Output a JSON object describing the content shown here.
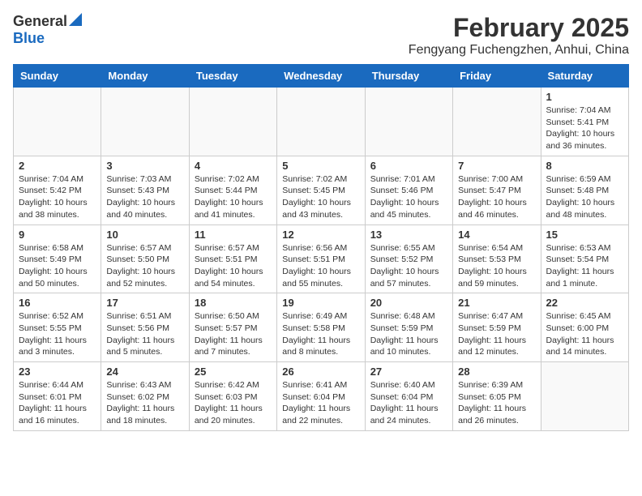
{
  "logo": {
    "general": "General",
    "blue": "Blue"
  },
  "title": "February 2025",
  "subtitle": "Fengyang Fuchengzhen, Anhui, China",
  "days_of_week": [
    "Sunday",
    "Monday",
    "Tuesday",
    "Wednesday",
    "Thursday",
    "Friday",
    "Saturday"
  ],
  "weeks": [
    [
      {
        "day": "",
        "info": ""
      },
      {
        "day": "",
        "info": ""
      },
      {
        "day": "",
        "info": ""
      },
      {
        "day": "",
        "info": ""
      },
      {
        "day": "",
        "info": ""
      },
      {
        "day": "",
        "info": ""
      },
      {
        "day": "1",
        "info": "Sunrise: 7:04 AM\nSunset: 5:41 PM\nDaylight: 10 hours and 36 minutes."
      }
    ],
    [
      {
        "day": "2",
        "info": "Sunrise: 7:04 AM\nSunset: 5:42 PM\nDaylight: 10 hours and 38 minutes."
      },
      {
        "day": "3",
        "info": "Sunrise: 7:03 AM\nSunset: 5:43 PM\nDaylight: 10 hours and 40 minutes."
      },
      {
        "day": "4",
        "info": "Sunrise: 7:02 AM\nSunset: 5:44 PM\nDaylight: 10 hours and 41 minutes."
      },
      {
        "day": "5",
        "info": "Sunrise: 7:02 AM\nSunset: 5:45 PM\nDaylight: 10 hours and 43 minutes."
      },
      {
        "day": "6",
        "info": "Sunrise: 7:01 AM\nSunset: 5:46 PM\nDaylight: 10 hours and 45 minutes."
      },
      {
        "day": "7",
        "info": "Sunrise: 7:00 AM\nSunset: 5:47 PM\nDaylight: 10 hours and 46 minutes."
      },
      {
        "day": "8",
        "info": "Sunrise: 6:59 AM\nSunset: 5:48 PM\nDaylight: 10 hours and 48 minutes."
      }
    ],
    [
      {
        "day": "9",
        "info": "Sunrise: 6:58 AM\nSunset: 5:49 PM\nDaylight: 10 hours and 50 minutes."
      },
      {
        "day": "10",
        "info": "Sunrise: 6:57 AM\nSunset: 5:50 PM\nDaylight: 10 hours and 52 minutes."
      },
      {
        "day": "11",
        "info": "Sunrise: 6:57 AM\nSunset: 5:51 PM\nDaylight: 10 hours and 54 minutes."
      },
      {
        "day": "12",
        "info": "Sunrise: 6:56 AM\nSunset: 5:51 PM\nDaylight: 10 hours and 55 minutes."
      },
      {
        "day": "13",
        "info": "Sunrise: 6:55 AM\nSunset: 5:52 PM\nDaylight: 10 hours and 57 minutes."
      },
      {
        "day": "14",
        "info": "Sunrise: 6:54 AM\nSunset: 5:53 PM\nDaylight: 10 hours and 59 minutes."
      },
      {
        "day": "15",
        "info": "Sunrise: 6:53 AM\nSunset: 5:54 PM\nDaylight: 11 hours and 1 minute."
      }
    ],
    [
      {
        "day": "16",
        "info": "Sunrise: 6:52 AM\nSunset: 5:55 PM\nDaylight: 11 hours and 3 minutes."
      },
      {
        "day": "17",
        "info": "Sunrise: 6:51 AM\nSunset: 5:56 PM\nDaylight: 11 hours and 5 minutes."
      },
      {
        "day": "18",
        "info": "Sunrise: 6:50 AM\nSunset: 5:57 PM\nDaylight: 11 hours and 7 minutes."
      },
      {
        "day": "19",
        "info": "Sunrise: 6:49 AM\nSunset: 5:58 PM\nDaylight: 11 hours and 8 minutes."
      },
      {
        "day": "20",
        "info": "Sunrise: 6:48 AM\nSunset: 5:59 PM\nDaylight: 11 hours and 10 minutes."
      },
      {
        "day": "21",
        "info": "Sunrise: 6:47 AM\nSunset: 5:59 PM\nDaylight: 11 hours and 12 minutes."
      },
      {
        "day": "22",
        "info": "Sunrise: 6:45 AM\nSunset: 6:00 PM\nDaylight: 11 hours and 14 minutes."
      }
    ],
    [
      {
        "day": "23",
        "info": "Sunrise: 6:44 AM\nSunset: 6:01 PM\nDaylight: 11 hours and 16 minutes."
      },
      {
        "day": "24",
        "info": "Sunrise: 6:43 AM\nSunset: 6:02 PM\nDaylight: 11 hours and 18 minutes."
      },
      {
        "day": "25",
        "info": "Sunrise: 6:42 AM\nSunset: 6:03 PM\nDaylight: 11 hours and 20 minutes."
      },
      {
        "day": "26",
        "info": "Sunrise: 6:41 AM\nSunset: 6:04 PM\nDaylight: 11 hours and 22 minutes."
      },
      {
        "day": "27",
        "info": "Sunrise: 6:40 AM\nSunset: 6:04 PM\nDaylight: 11 hours and 24 minutes."
      },
      {
        "day": "28",
        "info": "Sunrise: 6:39 AM\nSunset: 6:05 PM\nDaylight: 11 hours and 26 minutes."
      },
      {
        "day": "",
        "info": ""
      }
    ]
  ]
}
